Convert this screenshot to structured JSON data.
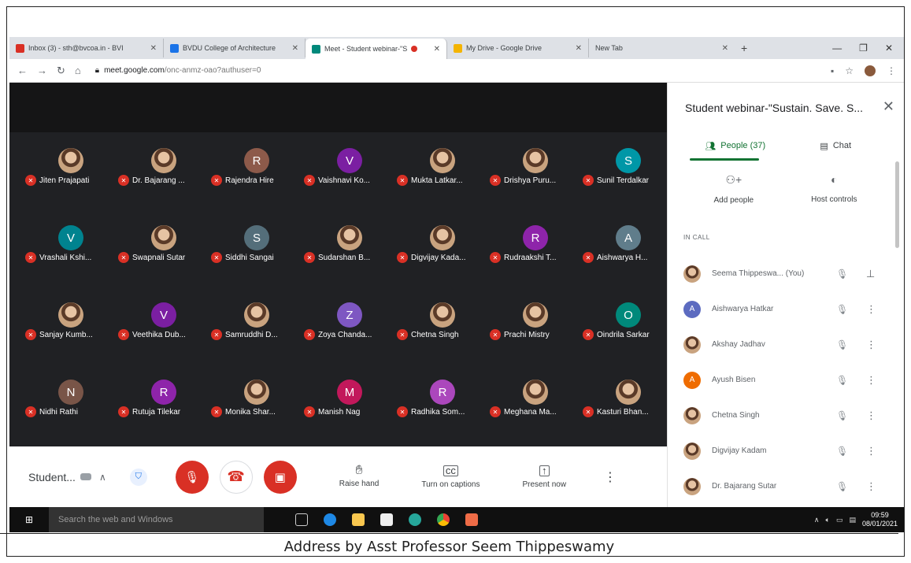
{
  "browser": {
    "tabs": [
      {
        "label": "Inbox (3) - sth@bvcoa.in - BVI",
        "icon_color": "#d93025",
        "icon": "gmail-icon",
        "active": false
      },
      {
        "label": "BVDU College of Architecture",
        "icon_color": "#1a73e8",
        "icon": "classroom-icon",
        "active": false
      },
      {
        "label": "Meet - Student webinar-\"S",
        "icon_color": "#00897b",
        "icon": "meet-icon",
        "active": true
      },
      {
        "label": "My Drive - Google Drive",
        "icon_color": "#f4b400",
        "icon": "drive-icon",
        "active": false
      },
      {
        "label": "New Tab",
        "icon_color": "#9aa0a6",
        "icon": "newtab-icon",
        "active": false
      }
    ],
    "url_host": "meet.google.com",
    "url_path": "/onc-anmz-oao?authuser=0"
  },
  "participants": [
    {
      "name": "Jiten Prajapati",
      "initial": "",
      "color": "#7cb342",
      "photo": true
    },
    {
      "name": "Dr. Bajarang ...",
      "initial": "",
      "color": "#8d6e63",
      "photo": true
    },
    {
      "name": "Rajendra Hire",
      "initial": "R",
      "color": "#8d5a4a",
      "photo": false
    },
    {
      "name": "Vaishnavi Ko...",
      "initial": "V",
      "color": "#7b1fa2",
      "photo": false
    },
    {
      "name": "Mukta Latkar...",
      "initial": "",
      "color": "#8d6e63",
      "photo": true
    },
    {
      "name": "Drishya Puru...",
      "initial": "",
      "color": "#eeeeee",
      "photo": true
    },
    {
      "name": "Sunil Terdalkar",
      "initial": "S",
      "color": "#0097a7",
      "photo": false
    },
    {
      "name": "Vrashali Kshi...",
      "initial": "V",
      "color": "#00838f",
      "photo": false
    },
    {
      "name": "Swapnali Sutar",
      "initial": "",
      "color": "#8d6e63",
      "photo": true
    },
    {
      "name": "Siddhi Sangai",
      "initial": "S",
      "color": "#546e7a",
      "photo": false
    },
    {
      "name": "Sudarshan B...",
      "initial": "",
      "color": "#8d6e63",
      "photo": true
    },
    {
      "name": "Digvijay Kada...",
      "initial": "",
      "color": "#3f51b5",
      "photo": true
    },
    {
      "name": "Rudraakshi T...",
      "initial": "R",
      "color": "#8e24aa",
      "photo": false
    },
    {
      "name": "Aishwarya H...",
      "initial": "A",
      "color": "#607d8b",
      "photo": false
    },
    {
      "name": "Sanjay Kumb...",
      "initial": "",
      "color": "#8d6e63",
      "photo": true
    },
    {
      "name": "Veethika Dub...",
      "initial": "V",
      "color": "#7b1fa2",
      "photo": false
    },
    {
      "name": "Samruddhi D...",
      "initial": "",
      "color": "#8d6e63",
      "photo": true
    },
    {
      "name": "Zoya Chanda...",
      "initial": "Z",
      "color": "#7e57c2",
      "photo": false
    },
    {
      "name": "Chetna Singh",
      "initial": "",
      "color": "#8d6e63",
      "photo": true
    },
    {
      "name": "Prachi Mistry",
      "initial": "",
      "color": "#8d6e63",
      "photo": true
    },
    {
      "name": "Oindrila Sarkar",
      "initial": "O",
      "color": "#00897b",
      "photo": false
    },
    {
      "name": "Nidhi Rathi",
      "initial": "N",
      "color": "#795548",
      "photo": false
    },
    {
      "name": "Rutuja Tilekar",
      "initial": "R",
      "color": "#8e24aa",
      "photo": false
    },
    {
      "name": "Monika Shar...",
      "initial": "",
      "color": "#8d6e63",
      "photo": true
    },
    {
      "name": "Manish Nag",
      "initial": "M",
      "color": "#c2185b",
      "photo": false
    },
    {
      "name": "Radhika Som...",
      "initial": "R",
      "color": "#ab47bc",
      "photo": false
    },
    {
      "name": "Meghana Ma...",
      "initial": "",
      "color": "#8d6e63",
      "photo": true
    },
    {
      "name": "Kasturi Bhan...",
      "initial": "",
      "color": "#8d6e63",
      "photo": true
    }
  ],
  "controls": {
    "meeting_name": "Student...",
    "raise_hand": "Raise hand",
    "captions": "Turn on captions",
    "present": "Present now"
  },
  "panel": {
    "title": "Student webinar-\"Sustain. Save. S...",
    "people_tab": "People (37)",
    "chat_tab": "Chat",
    "add_people": "Add people",
    "host_controls": "Host controls",
    "in_call": "IN CALL",
    "list": [
      {
        "name": "Seema Thippeswa... (You)",
        "initial": "",
        "color": "#8d6e63",
        "photo": true,
        "pin": true
      },
      {
        "name": "Aishwarya Hatkar",
        "initial": "A",
        "color": "#5c6bc0",
        "photo": false,
        "pin": false
      },
      {
        "name": "Akshay Jadhav",
        "initial": "",
        "color": "#2e7d32",
        "photo": true,
        "pin": false
      },
      {
        "name": "Ayush Bisen",
        "initial": "A",
        "color": "#ef6c00",
        "photo": false,
        "pin": false
      },
      {
        "name": "Chetna Singh",
        "initial": "",
        "color": "#8d6e63",
        "photo": true,
        "pin": false
      },
      {
        "name": "Digvijay Kadam",
        "initial": "",
        "color": "#3f51b5",
        "photo": true,
        "pin": false
      },
      {
        "name": "Dr. Bajarang Sutar",
        "initial": "",
        "color": "#8d6e63",
        "photo": true,
        "pin": false
      }
    ]
  },
  "taskbar": {
    "search_placeholder": "Search the web and Windows",
    "time": "09:59",
    "date": "08/01/2021"
  },
  "caption": "Address by Asst Professor Seem Thippeswamy"
}
